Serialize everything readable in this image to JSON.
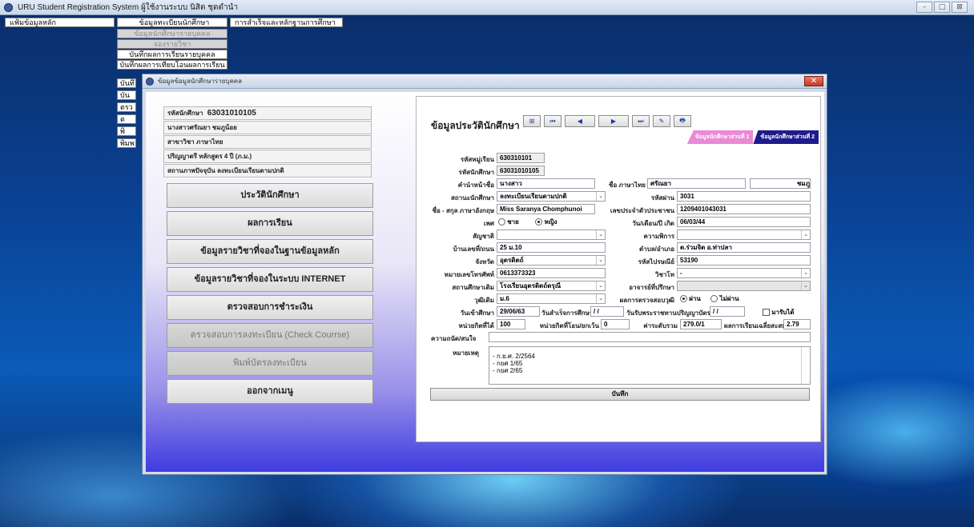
{
  "app": {
    "title": "URU Student Registration System ผู้ใช้งานระบบ นิสิต ชุดตำนำ",
    "controls": [
      "–",
      "□",
      "⊠"
    ]
  },
  "menu": {
    "main": "แฟ้มข้อมูลหลัก",
    "registration": "ข้อมูลทะเบียนนักศึกษา",
    "graduation": "การสำเร็จและหลักฐานการศึกษา",
    "submenu": [
      {
        "label": "ข้อมูลนักศึกษารายบุคคล",
        "disabled": true
      },
      {
        "label": "จองรายวิชา",
        "disabled": true
      },
      {
        "label": "บันทึกผลการเรียนรายบุคคล",
        "disabled": false
      },
      {
        "label": "บันทึกผลการเทียบโอนผลการเรียน",
        "disabled": false
      }
    ],
    "stubs": [
      "บันทึ",
      "บัน",
      "ตรว",
      "ต",
      "พิ",
      "พิมพ"
    ]
  },
  "dialog": {
    "title": "ข้อมูลข้อมูลนักศึกษารายบุคคล",
    "close": "✕",
    "student_info": {
      "id_label": "รหัสนักศึกษา",
      "id_value": "63031010105",
      "name": "นางสาวศรัณยา ชมภูน้อย",
      "major": "สาขาวิชา ภาษาไทย",
      "degree": "ปริญญาตรี หลักสูตร 4 ปี (ภ.ม.)",
      "status": "สถานภาพปัจจุบัน ลงทะเบียนเรียนตามปกติ"
    },
    "menu_buttons": [
      {
        "label": "ประวัตินักศึกษา",
        "disabled": false
      },
      {
        "label": "ผลการเรียน",
        "disabled": false
      },
      {
        "label": "ข้อมูลรายวิชาที่จองในฐานข้อมูลหลัก",
        "disabled": false
      },
      {
        "label": "ข้อมูลรายวิชาที่จองในระบบ INTERNET",
        "disabled": false
      },
      {
        "label": "ตรวจสอบการชำระเงิน",
        "disabled": false
      },
      {
        "label": "ตรวจสอบการลงทะเบียน (Check Courrse)",
        "disabled": true
      },
      {
        "label": "พิมพ์บัตรลงทะเบียน",
        "disabled": true
      },
      {
        "label": "ออกจากเมนู",
        "disabled": false
      }
    ],
    "panel": {
      "heading": "ข้อมูลประวัตินักศึกษา",
      "toolbar": [
        "⊞",
        "⏮",
        "◀",
        "▶",
        "⏭",
        "✎",
        "🖶"
      ],
      "tabs": [
        "ข้อมูลนักศึกษาส่วนที่ 1",
        "ข้อมูลนักศึกษาส่วนที่ 2"
      ],
      "fields": {
        "group_code_label": "รหัสหมู่เรียน",
        "group_code": "630310101",
        "student_id_label": "รหัสนักศึกษา",
        "student_id": "63031010105",
        "prefix_label": "คำนำหน้าชื่อ",
        "prefix": "นางสาว",
        "firstname_label": "ชื่อ ภาษาไทย",
        "firstname": "ศรัณยา",
        "lastname_label": "สกุล ภาษาไทย",
        "lastname": "ชมภูน้อย",
        "status_label": "สถานะนักศึกษา",
        "status": "ลงทะเบียนเรียนตามปกติ",
        "password_label": "รหัสผ่าน",
        "password": "3031",
        "en_name_label": "ชื่อ - สกุล ภาษาอังกฤษ",
        "en_name": "Miss Saranya  Chomphunoi",
        "citizen_label": "เลขประจำตัวประชาชน",
        "citizen": "1209401043031",
        "gender_label": "เพศ",
        "gender_male": "ชาย",
        "gender_female": "หญิง",
        "birth_label": "วัน/เดือน/ปี เกิด",
        "birth": "06/03/44",
        "nationality_label": "สัญชาติ",
        "nationality": "",
        "disability_label": "ความพิการ",
        "disability": "",
        "address_label": "บ้านเลขที่/ถนน",
        "address": "25 ม.10",
        "subdistrict_label": "ตำบล/อำเภอ",
        "subdistrict": "ต.ร่วมจิต  อ.ท่าปลา",
        "province_label": "จังหวัด",
        "province": "อุตรดิตถ์",
        "postcode_label": "รหัสไปรษณีย์",
        "postcode": "53190",
        "phone_label": "หมายเลขโทรศัพท์",
        "phone": "0613373323",
        "major_label": "วิชาโท",
        "major": "-",
        "school_label": "สถานศึกษาเดิม",
        "school": "โรงเรียนอุตรดิตถ์ดรุณี",
        "advisor_label": "อาจารย์ที่ปรึกษา",
        "advisor": "",
        "edu_label": "วุฒิเดิม",
        "edu": "ม.6",
        "exam_label": "ผลการตรวจสอบวุฒิ",
        "exam_pass": "ผ่าน",
        "exam_fail": "ไม่ผ่าน",
        "enroll_label": "วันเข้าศึกษา",
        "enroll": "29/06/63",
        "graduate_label": "วันสำเร็จการศึกษา",
        "graduate": "/ /",
        "degree_label": "วันรับพระราชทานปริญญาบัตร",
        "degree_date": "/ /",
        "received_label": "มารับได้",
        "credits_label": "หน่วยกิตที่ได้",
        "credits": "100",
        "transfer_label": "หน่วยกิตที่โอน/ยกเว้น",
        "transfer": "0",
        "grade_label": "ค่าระดับรวม",
        "grade": "279.0/1",
        "gpa_label": "ผลการเรียนเฉลี่ยสะสม",
        "gpa": "2.79",
        "talent_label": "ความถนัด/สนใจ",
        "talent": "",
        "remark_label": "หมายเหตุ",
        "remarks": [
          "- ก.ย.ศ. 2/2564",
          "- กยศ 1/65",
          "- กยศ 2/65"
        ]
      },
      "save": "บันทึก"
    }
  }
}
